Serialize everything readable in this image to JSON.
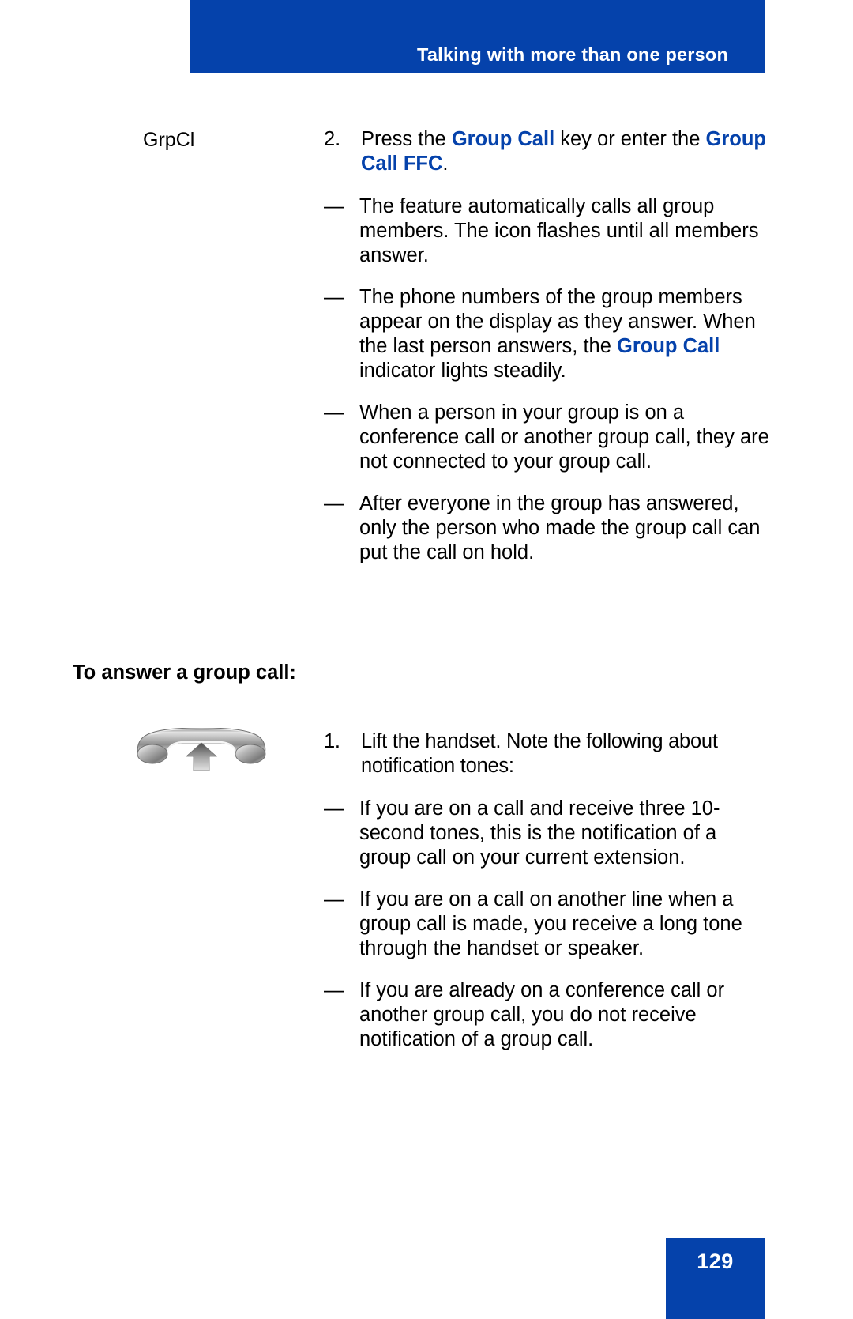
{
  "header": {
    "title": "Talking with more than one person",
    "band_color": "#0542AB"
  },
  "footer": {
    "page_number": "129",
    "band_color": "#0542AB"
  },
  "steps": [
    {
      "gutter_label": "GrpCl",
      "number": "2.",
      "text_parts": [
        {
          "text": "Press the ",
          "style": "normal"
        },
        {
          "text": "Group Call",
          "style": "highlight"
        },
        {
          "text": " key or enter the ",
          "style": "normal"
        },
        {
          "text": "Group Call FFC",
          "style": "highlight"
        },
        {
          "text": ".",
          "style": "normal"
        }
      ],
      "bullets": [
        {
          "dash": "—",
          "parts": [
            {
              "text": "The feature automatically calls all group members. The icon flashes until all members answer.",
              "style": "normal"
            }
          ]
        },
        {
          "dash": "—",
          "parts": [
            {
              "text": "The phone numbers of the group members appear on the display as they answer. When the last person answers, the ",
              "style": "normal"
            },
            {
              "text": "Group Call",
              "style": "highlight"
            },
            {
              "text": " indicator lights steadily.",
              "style": "normal"
            }
          ]
        },
        {
          "dash": "—",
          "parts": [
            {
              "text": "When a person in your group is on a conference call or another group call, they are not connected to your group call.",
              "style": "normal"
            }
          ]
        },
        {
          "dash": "—",
          "parts": [
            {
              "text": "After everyone in the group has answered, only the person who made the group call can put the call on hold.",
              "style": "normal"
            }
          ]
        }
      ]
    }
  ],
  "section": {
    "heading": "To answer a group call:",
    "gutter_icon": "handset-lift-icon",
    "number": "1.",
    "text_parts": [
      {
        "text": "Lift the handset. Note the following about notification tones:",
        "style": "normal"
      }
    ],
    "bullets": [
      {
        "dash": "—",
        "parts": [
          {
            "text": "If you are on a call and receive three 10-second tones, this is the notification of a group call on your current extension.",
            "style": "normal"
          }
        ]
      },
      {
        "dash": "—",
        "parts": [
          {
            "text": "If you are on a call on another line when a group call is made, you receive a long tone through the handset or speaker.",
            "style": "normal"
          }
        ]
      },
      {
        "dash": "—",
        "parts": [
          {
            "text": "If you are already on a conference call or another group call, you do not receive notification of a group call.",
            "style": "normal"
          }
        ]
      }
    ]
  }
}
